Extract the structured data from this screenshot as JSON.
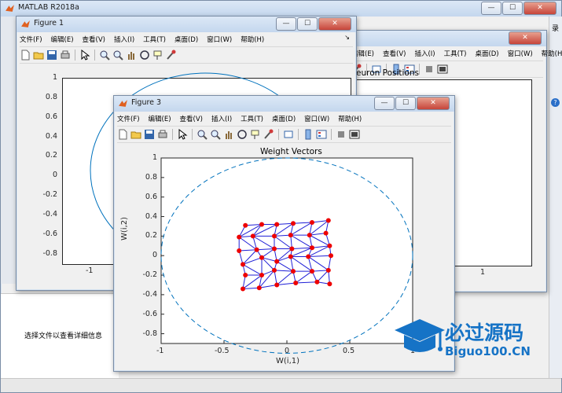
{
  "matlab": {
    "title": "MATLAB R2018a",
    "status_text": "选择文件以查看详细信息",
    "right_edge_glyph": "录"
  },
  "window_buttons": {
    "min": "—",
    "max": "☐",
    "close": "✕"
  },
  "menu": [
    "文件(F)",
    "编辑(E)",
    "查看(V)",
    "插入(I)",
    "工具(T)",
    "桌面(D)",
    "窗口(W)",
    "帮助(H)"
  ],
  "menu_overflow": "↘",
  "figure1": {
    "title": "Figure 1",
    "yticks": [
      "1",
      "0.8",
      "0.6",
      "0.4",
      "0.2",
      "0",
      "-0.2",
      "-0.4",
      "-0.6",
      "-0.8"
    ],
    "xticks": [
      "-1"
    ]
  },
  "figure2": {
    "title_partial": "euron Positions",
    "xticks": [
      "1"
    ]
  },
  "figure3": {
    "title": "Figure 3",
    "plot_title": "Weight Vectors",
    "xlabel": "W(i,1)",
    "ylabel": "W(i,2)",
    "xticks": [
      "-1",
      "-0.5",
      "0",
      "0.5",
      "1"
    ],
    "yticks": [
      "1",
      "0.8",
      "0.6",
      "0.4",
      "0.2",
      "0",
      "-0.2",
      "-0.4",
      "-0.6",
      "-0.8"
    ]
  },
  "chart_data": {
    "type": "scatter",
    "title": "Weight Vectors",
    "xlabel": "W(i,1)",
    "ylabel": "W(i,2)",
    "xlim": [
      -1,
      1
    ],
    "ylim": [
      -0.9,
      1
    ],
    "grid_cols": 6,
    "grid_rows": 6,
    "points": [
      [
        -0.33,
        0.31
      ],
      [
        -0.2,
        0.32
      ],
      [
        -0.08,
        0.32
      ],
      [
        0.05,
        0.33
      ],
      [
        0.2,
        0.34
      ],
      [
        0.33,
        0.36
      ],
      [
        -0.38,
        0.19
      ],
      [
        -0.27,
        0.2
      ],
      [
        -0.1,
        0.2
      ],
      [
        0.03,
        0.21
      ],
      [
        0.18,
        0.21
      ],
      [
        0.31,
        0.23
      ],
      [
        -0.38,
        0.05
      ],
      [
        -0.24,
        0.06
      ],
      [
        -0.1,
        0.07
      ],
      [
        0.04,
        0.07
      ],
      [
        0.2,
        0.08
      ],
      [
        0.34,
        0.1
      ],
      [
        -0.35,
        -0.09
      ],
      [
        -0.2,
        -0.02
      ],
      [
        -0.08,
        -0.06
      ],
      [
        0.03,
        -0.01
      ],
      [
        0.17,
        -0.01
      ],
      [
        0.35,
        0
      ],
      [
        -0.33,
        -0.2
      ],
      [
        -0.2,
        -0.2
      ],
      [
        -0.1,
        -0.15
      ],
      [
        0.05,
        -0.16
      ],
      [
        0.2,
        -0.16
      ],
      [
        0.33,
        -0.15
      ],
      [
        -0.35,
        -0.34
      ],
      [
        -0.22,
        -0.33
      ],
      [
        -0.08,
        -0.3
      ],
      [
        0.07,
        -0.28
      ],
      [
        0.24,
        -0.27
      ],
      [
        0.34,
        -0.29
      ]
    ],
    "circle_radius": 1,
    "colors": {
      "points": "#ee0000",
      "lines": "#1f1fd6",
      "circle": "#0072bd"
    }
  },
  "watermark": {
    "title": "必过源码",
    "url": "Biguo100.CN",
    "color": "#1673c6"
  }
}
